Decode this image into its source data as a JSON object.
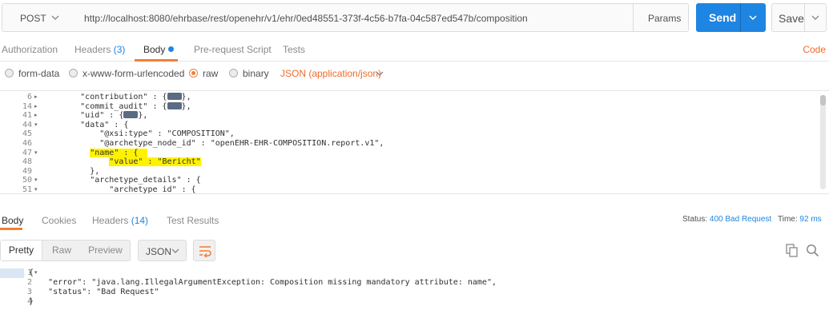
{
  "request": {
    "method": "POST",
    "url": "http://localhost:8080/ehrbase/rest/openehr/v1/ehr/0ed48551-373f-4c56-b7fa-04c587ed547b/composition",
    "params_label": "Params",
    "send_label": "Send",
    "save_label": "Save"
  },
  "request_tabs": {
    "authorization": "Authorization",
    "headers": "Headers",
    "headers_count": "(3)",
    "body": "Body",
    "pre_request": "Pre-request Script",
    "tests": "Tests",
    "code": "Code"
  },
  "body_modes": {
    "form_data": "form-data",
    "urlencoded": "x-www-form-urlencoded",
    "raw": "raw",
    "binary": "binary",
    "content_type": "JSON (application/json)",
    "selected": "raw"
  },
  "editor": {
    "lines": [
      {
        "n": "6",
        "fold": "▸",
        "text": "        \"contribution\" : {",
        "collapsed": true,
        "tail": "},"
      },
      {
        "n": "14",
        "fold": "▸",
        "text": "        \"commit_audit\" : {",
        "collapsed": true,
        "tail": "},"
      },
      {
        "n": "41",
        "fold": "▸",
        "text": "        \"uid\" : {",
        "collapsed": true,
        "tail": "},"
      },
      {
        "n": "44",
        "fold": "▾",
        "text": "        \"data\" : {"
      },
      {
        "n": "45",
        "fold": "",
        "text": "            \"@xsi:type\" : \"COMPOSITION\","
      },
      {
        "n": "46",
        "fold": "",
        "text": "            \"@archetype_node_id\" : \"openEHR-EHR-COMPOSITION.report.v1\","
      },
      {
        "n": "47",
        "fold": "▾",
        "pre": "          ",
        "hl": "\"name\" : {  "
      },
      {
        "n": "48",
        "fold": "",
        "pre": "              ",
        "hl": "\"value\" : \"Bericht\""
      },
      {
        "n": "49",
        "fold": "",
        "text": "          },"
      },
      {
        "n": "50",
        "fold": "▾",
        "text": "          \"archetype_details\" : {"
      },
      {
        "n": "51",
        "fold": "▾",
        "text": "              \"archetype_id\" : {"
      }
    ]
  },
  "response_tabs": {
    "body": "Body",
    "cookies": "Cookies",
    "headers": "Headers",
    "headers_count": "(14)",
    "test_results": "Test Results",
    "status_label": "Status:",
    "status_value": "400 Bad Request",
    "time_label": "Time:",
    "time_value": "92 ms"
  },
  "response_toolbar": {
    "pretty": "Pretty",
    "raw": "Raw",
    "preview": "Preview",
    "format": "JSON"
  },
  "response_body": {
    "lines": [
      {
        "n": "1",
        "fold": "▾",
        "text": "{"
      },
      {
        "n": "2",
        "fold": "",
        "text": "    \"error\": \"java.lang.IllegalArgumentException: Composition missing mandatory attribute: name\","
      },
      {
        "n": "3",
        "fold": "",
        "text": "    \"status\": \"Bad Request\""
      },
      {
        "n": "4",
        "fold": "",
        "text": "}"
      }
    ]
  },
  "colors": {
    "accent_orange": "#f27f36",
    "accent_blue": "#1f85e2",
    "highlight_yellow": "#fff200"
  },
  "icons": {
    "method_dropdown": "chevron-down-icon",
    "send_dropdown": "chevron-down-icon",
    "save_dropdown": "chevron-down-icon",
    "wrap_lines": "wrap-lines-icon",
    "copy": "copy-icon",
    "search": "search-icon"
  }
}
